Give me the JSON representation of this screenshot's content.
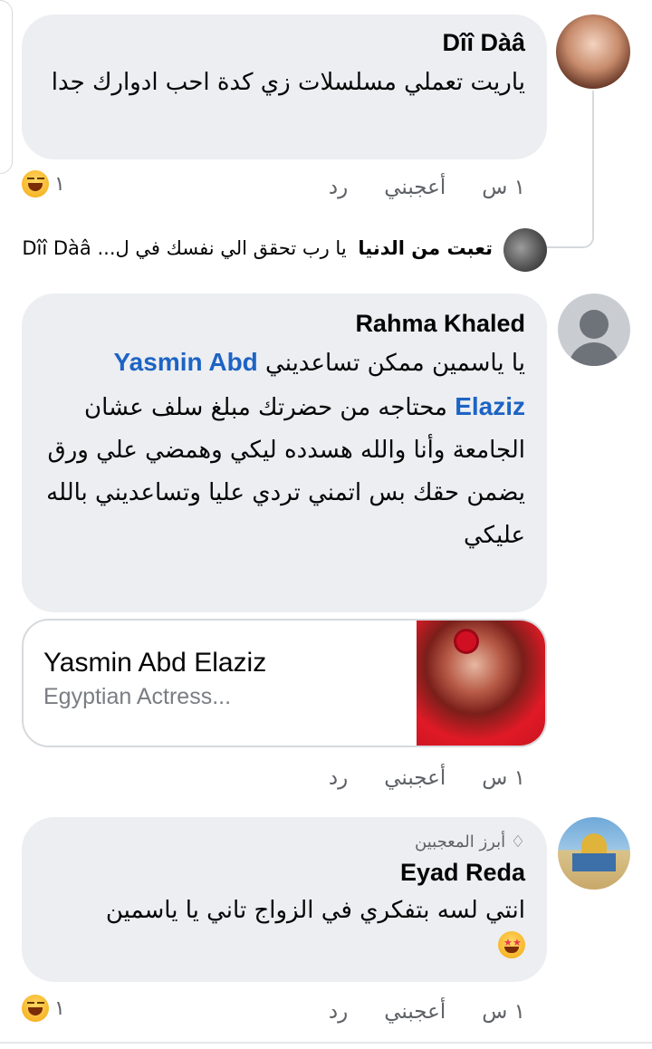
{
  "comments": [
    {
      "author": "Dîî Dàâ",
      "text": "ياريت تعملي مسلسلات زي كدة احب ادوارك جدا",
      "time": "١ س",
      "like_label": "أعجبني",
      "reply_label": "رد",
      "reaction_count": "١",
      "reaction_icon": "laughing-emoji"
    },
    {
      "author": "Rahma Khaled",
      "text_prefix": "يا ياسمين ممكن تساعديني",
      "mention": "Yasmin Abd Elaziz",
      "text_body": "محتاجه من حضرتك مبلغ سلف عشان الجامعة وأنا والله هسدده ليكي وهمضي علي ورق يضمن حقك بس اتمني تردي عليا وتساعديني بالله عليكي",
      "link_title": "Yasmin Abd Elaziz",
      "link_subtitle": "Egyptian Actress...",
      "time": "١ س",
      "like_label": "أعجبني",
      "reply_label": "رد"
    },
    {
      "badge": "أبرز المعجبين",
      "badge_icon": "diamond-icon",
      "author": "Eyad Reda",
      "text": "انتي لسه بتفكري في الزواج تاني يا ياسمين",
      "text_emoji": "star-struck-emoji",
      "time": "١ س",
      "like_label": "أعجبني",
      "reply_label": "رد",
      "reaction_count": "١",
      "reaction_icon": "laughing-emoji"
    }
  ],
  "reply_preview": {
    "author": "تعبت من الدنيا",
    "text": "يا رب تحقق الي نفسك في ل... Dîî Dàâ"
  },
  "colors": {
    "bubble": "#eceef1",
    "mention": "#1d63c4",
    "secondary_text": "#5e6166"
  }
}
